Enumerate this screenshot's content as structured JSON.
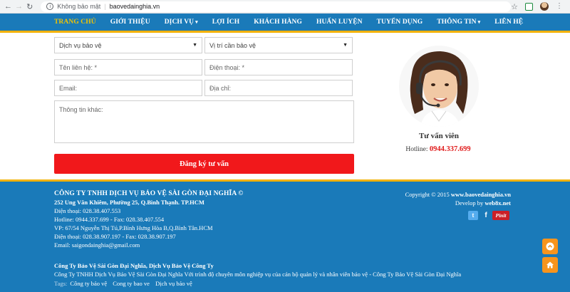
{
  "browser": {
    "security_label": "Không bảo mật",
    "separator": "|",
    "url": "baovedainghia.vn"
  },
  "nav": {
    "items": [
      {
        "label": "TRANG CHỦ",
        "active": true
      },
      {
        "label": "GIỚI THIỆU"
      },
      {
        "label": "DỊCH VỤ",
        "dropdown": true
      },
      {
        "label": "LỢI ÍCH"
      },
      {
        "label": "KHÁCH HÀNG"
      },
      {
        "label": "HUẤN LUYỆN"
      },
      {
        "label": "TUYỂN DỤNG"
      },
      {
        "label": "THÔNG TIN",
        "dropdown": true
      },
      {
        "label": "LIÊN HỆ"
      }
    ]
  },
  "form": {
    "service_select": "Dịch vụ bảo vệ",
    "position_select": "Vị trí cần bảo vệ",
    "contact_name_placeholder": "Tên liên hệ: *",
    "phone_placeholder": "Điện thoại: *",
    "email_placeholder": "Email:",
    "address_placeholder": "Địa chỉ:",
    "other_info_placeholder": "Thông tin khác:",
    "submit_label": "Đăng ký tư vấn"
  },
  "consultant": {
    "title": "Tư vấn viên",
    "hotline_label": "Hotline:",
    "hotline_number": "0944.337.699"
  },
  "footer": {
    "company_name": "CÔNG TY TNHH DỊCH VỤ BẢO VỆ SÀI GÒN ĐẠI NGHĨA ©",
    "address": "252 Ung Văn Khiêm, Phường 25, Q.Bình Thạnh. TP.HCM",
    "phone": "Điện thoại: 028.38.407.553",
    "hotline_fax": "Hotline: 0944.337.699 - Fax: 028.38.407.554",
    "vp_address": "VP: 67/54 Nguyễn Thị Tú,P.Bình Hưng Hòa B,Q.Bình Tân.HCM",
    "phone2": "Điện thoại: 028.38.907.197 - Fax: 028.38.907.197",
    "email": "Email: saigondainghia@gmail.com",
    "seo_title": "Công Ty Bảo Vệ Sài Gòn Đại Nghĩa, Dịch Vụ Bảo Vệ Công Ty",
    "seo_desc": "Công Ty TNHH Dịch Vụ Bảo Vệ Sài Gòn Đại Nghĩa Với trình độ chuyên môn nghiệp vụ của cán bộ quản lý và nhân viên bảo vệ - Công Ty Bảo Vệ Sài Gòn Đại Nghĩa",
    "tags_label": "Tags:",
    "tags": [
      "Công ty bảo vệ",
      "Cong ty bao ve",
      "Dịch vụ bảo vệ"
    ],
    "copyright_prefix": "Copyright © 2015",
    "copyright_site": "www.baovedainghia.vn",
    "develop_prefix": "Develop by",
    "develop_by": "web8x.net",
    "social": {
      "twitter": "t",
      "facebook": "f",
      "pinterest": "Pinit"
    }
  },
  "colors": {
    "nav_bg": "#1a7ab9",
    "accent_yellow": "#f2b100",
    "submit_red": "#f1181b",
    "float_orange": "#f7941d"
  }
}
